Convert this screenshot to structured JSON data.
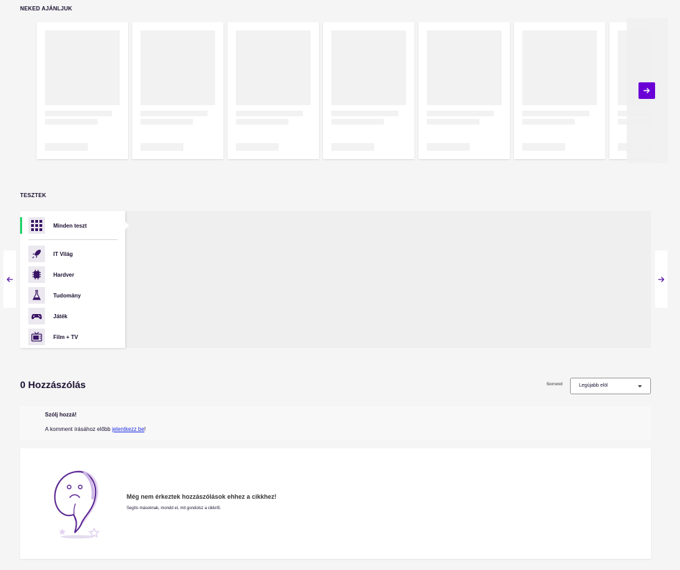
{
  "recommendations": {
    "title": "NEKED AJÁNLJUK",
    "next_icon": "arrow-right-icon",
    "accent_color": "#6b00d6"
  },
  "quizzes": {
    "title": "TESZTEK",
    "items": [
      {
        "label": "Minden teszt",
        "icon": "grid-icon",
        "active": true
      },
      {
        "label": "IT Világ",
        "icon": "rocket-icon"
      },
      {
        "label": "Hardver",
        "icon": "chip-icon"
      },
      {
        "label": "Tudomány",
        "icon": "flask-icon"
      },
      {
        "label": "Játék",
        "icon": "gamepad-icon"
      },
      {
        "label": "Film + TV",
        "icon": "tv-icon"
      }
    ],
    "active_color": "#22d36a"
  },
  "comments": {
    "title": "0 Hozzászólás",
    "sort_label": "Sorrend",
    "sort_value": "Legújabb elöl",
    "prompt_title": "Szólj hozzá!",
    "prompt_before": "A komment írásához előbb ",
    "prompt_link": "jelentkezz be",
    "prompt_after": "!",
    "empty_title": "Még nem érkeztek hozzászólások ehhez a cikkhez!",
    "empty_subtitle": "Segíts másoknak, mondd el, mit gondolsz a cikkről."
  }
}
